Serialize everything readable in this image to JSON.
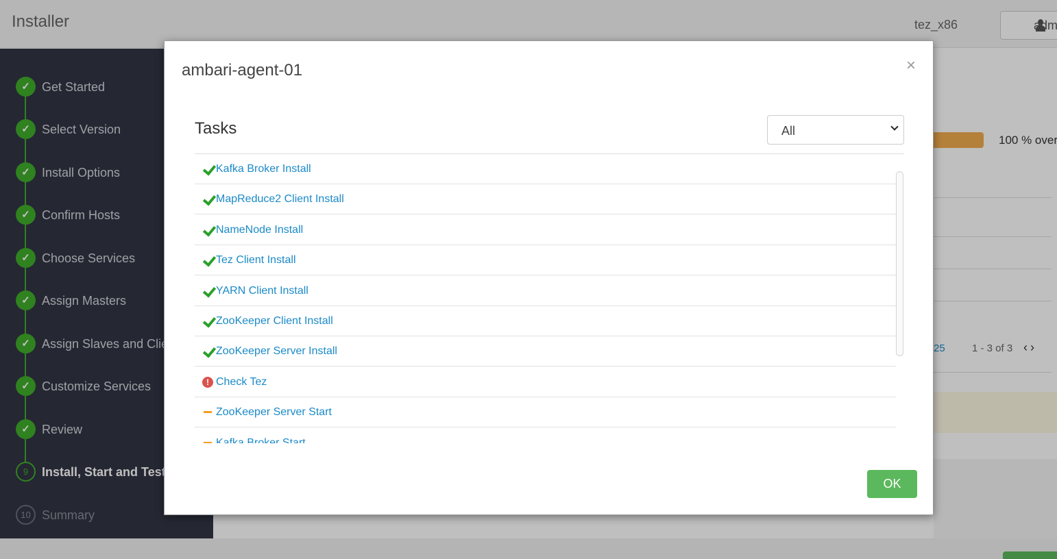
{
  "app": {
    "title": "Installer",
    "cluster": "tez_x86",
    "user": "adm"
  },
  "wizard": {
    "steps": [
      {
        "num": "1",
        "label": "Get Started",
        "state": "done"
      },
      {
        "num": "2",
        "label": "Select Version",
        "state": "done"
      },
      {
        "num": "3",
        "label": "Install Options",
        "state": "done"
      },
      {
        "num": "4",
        "label": "Confirm Hosts",
        "state": "done"
      },
      {
        "num": "5",
        "label": "Choose Services",
        "state": "done"
      },
      {
        "num": "6",
        "label": "Assign Masters",
        "state": "done"
      },
      {
        "num": "7",
        "label": "Assign Slaves and Clie",
        "state": "done"
      },
      {
        "num": "8",
        "label": "Customize Services",
        "state": "done"
      },
      {
        "num": "9",
        "label": "Review",
        "state": "done"
      },
      {
        "num": "9",
        "label": "Install, Start and Test",
        "state": "active"
      },
      {
        "num": "10",
        "label": "Summary",
        "state": "todo"
      }
    ]
  },
  "background": {
    "progress_percent": 100,
    "progress_text": "100 % over",
    "pager_size": "25",
    "pager_text": "1 - 3 of 3",
    "pager_arrows": "‹›"
  },
  "modal": {
    "title": "ambari-agent-01",
    "close_glyph": "×",
    "tasks_heading": "Tasks",
    "filter_value": "All",
    "ok_label": "OK",
    "tasks": [
      {
        "label": "Kafka Broker Install",
        "status": "completed",
        "icon": "check-icon"
      },
      {
        "label": "MapReduce2 Client Install",
        "status": "completed",
        "icon": "check-icon"
      },
      {
        "label": "NameNode Install",
        "status": "completed",
        "icon": "check-icon"
      },
      {
        "label": "Tez Client Install",
        "status": "completed",
        "icon": "check-icon"
      },
      {
        "label": "YARN Client Install",
        "status": "completed",
        "icon": "check-icon"
      },
      {
        "label": "ZooKeeper Client Install",
        "status": "completed",
        "icon": "check-icon"
      },
      {
        "label": "ZooKeeper Server Install",
        "status": "completed",
        "icon": "check-icon"
      },
      {
        "label": "Check Tez",
        "status": "failed",
        "icon": "error-icon"
      },
      {
        "label": "ZooKeeper Server Start",
        "status": "aborted",
        "icon": "dash-icon"
      },
      {
        "label": "Kafka Broker Start",
        "status": "aborted",
        "icon": "dash-icon"
      }
    ]
  },
  "colors": {
    "success": "#2aa02a",
    "error": "#d9534f",
    "warning": "#f0a020",
    "link": "#1b8ac7",
    "sidebar": "#323544",
    "ok_button": "#5cb85c"
  }
}
